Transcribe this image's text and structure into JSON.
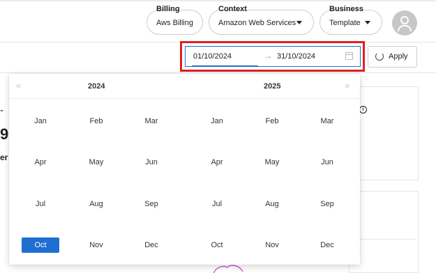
{
  "header": {
    "billing": {
      "caption": "Billing",
      "value": "Aws Billing"
    },
    "context": {
      "caption": "Context",
      "value": "Amazon Web Services"
    },
    "business": {
      "caption": "Business",
      "value": "Template"
    }
  },
  "filter": {
    "start_date": "01/10/2024",
    "separator": "→",
    "end_date": "31/10/2024",
    "apply_label": "Apply"
  },
  "background": {
    "info_glyph": "i",
    "fragment_1": "-",
    "fragment_2": "9",
    "fragment_3": "er"
  },
  "picker": {
    "prev_glyph": "«",
    "next_glyph": "»",
    "left_panel": {
      "year": "2024",
      "months": [
        [
          "Jan",
          "Feb",
          "Mar"
        ],
        [
          "Apr",
          "May",
          "Jun"
        ],
        [
          "Jul",
          "Aug",
          "Sep"
        ],
        [
          "Oct",
          "Nov",
          "Dec"
        ]
      ],
      "selected_month": "Oct"
    },
    "right_panel": {
      "year": "2025",
      "months": [
        [
          "Jan",
          "Feb",
          "Mar"
        ],
        [
          "Apr",
          "May",
          "Jun"
        ],
        [
          "Jul",
          "Aug",
          "Sep"
        ],
        [
          "Oct",
          "Nov",
          "Dec"
        ]
      ]
    }
  },
  "colors": {
    "accent": "#1f6fd1",
    "highlight_frame": "#e02020"
  }
}
